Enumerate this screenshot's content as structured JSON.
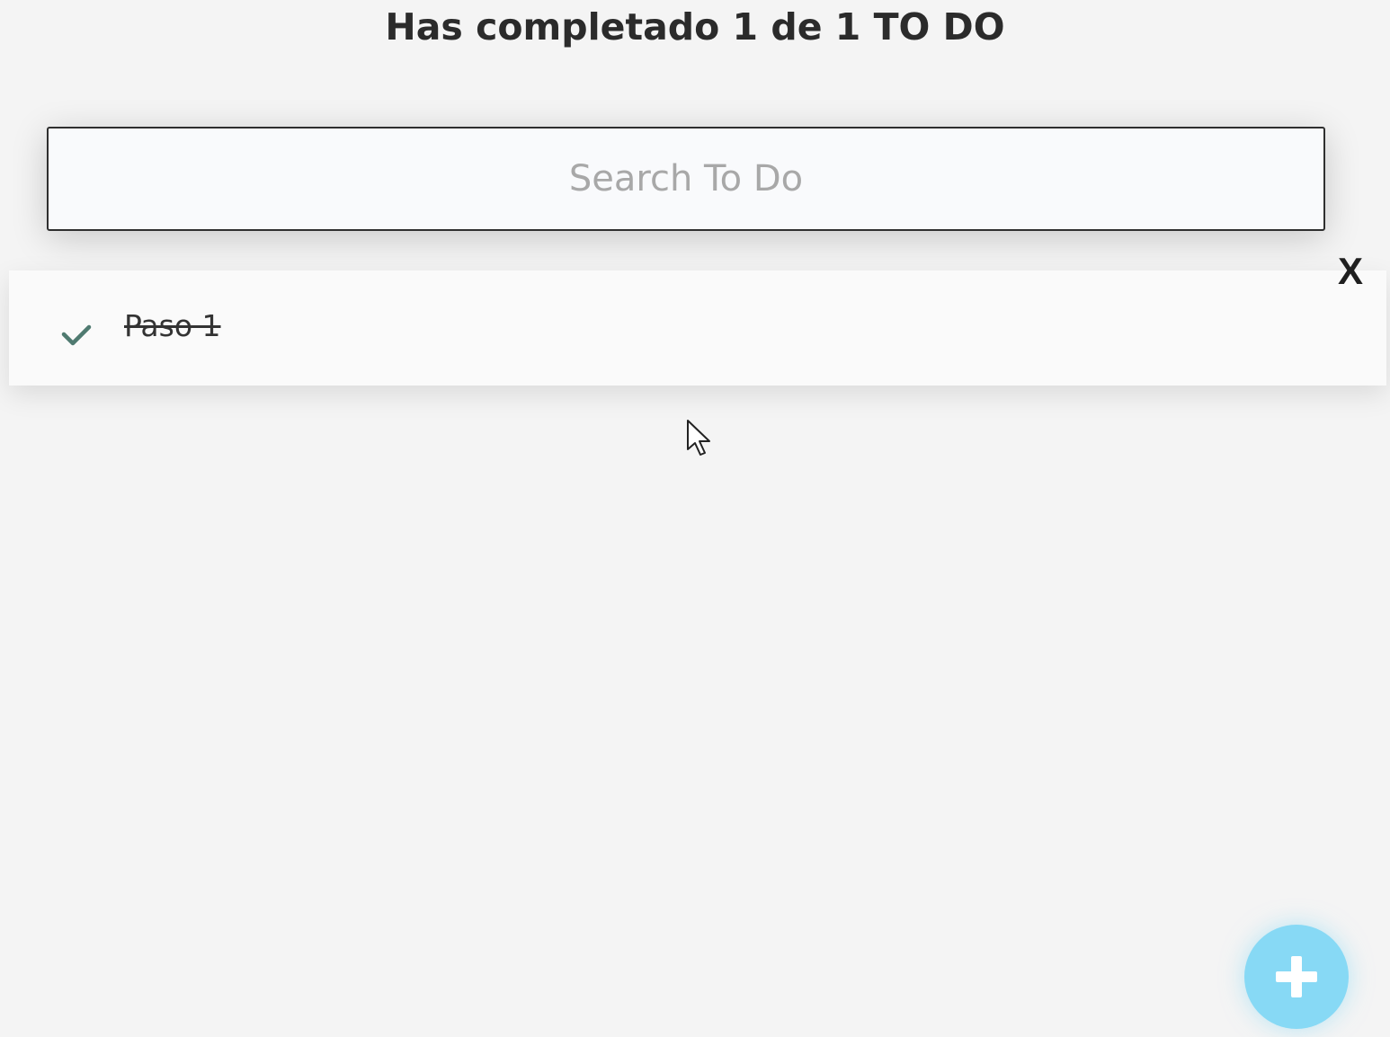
{
  "header": {
    "title": "Has completado 1 de 1 TO DO"
  },
  "search": {
    "placeholder": "Search To Do",
    "value": ""
  },
  "todos": [
    {
      "text": "Paso 1",
      "completed": true,
      "delete_label": "X",
      "check_icon": "check-icon"
    }
  ],
  "fab": {
    "icon": "plus-icon",
    "color": "#87d9f5"
  },
  "colors": {
    "background": "#f4f4f4",
    "check": "#4f7a70",
    "title": "#2b2b2b"
  }
}
